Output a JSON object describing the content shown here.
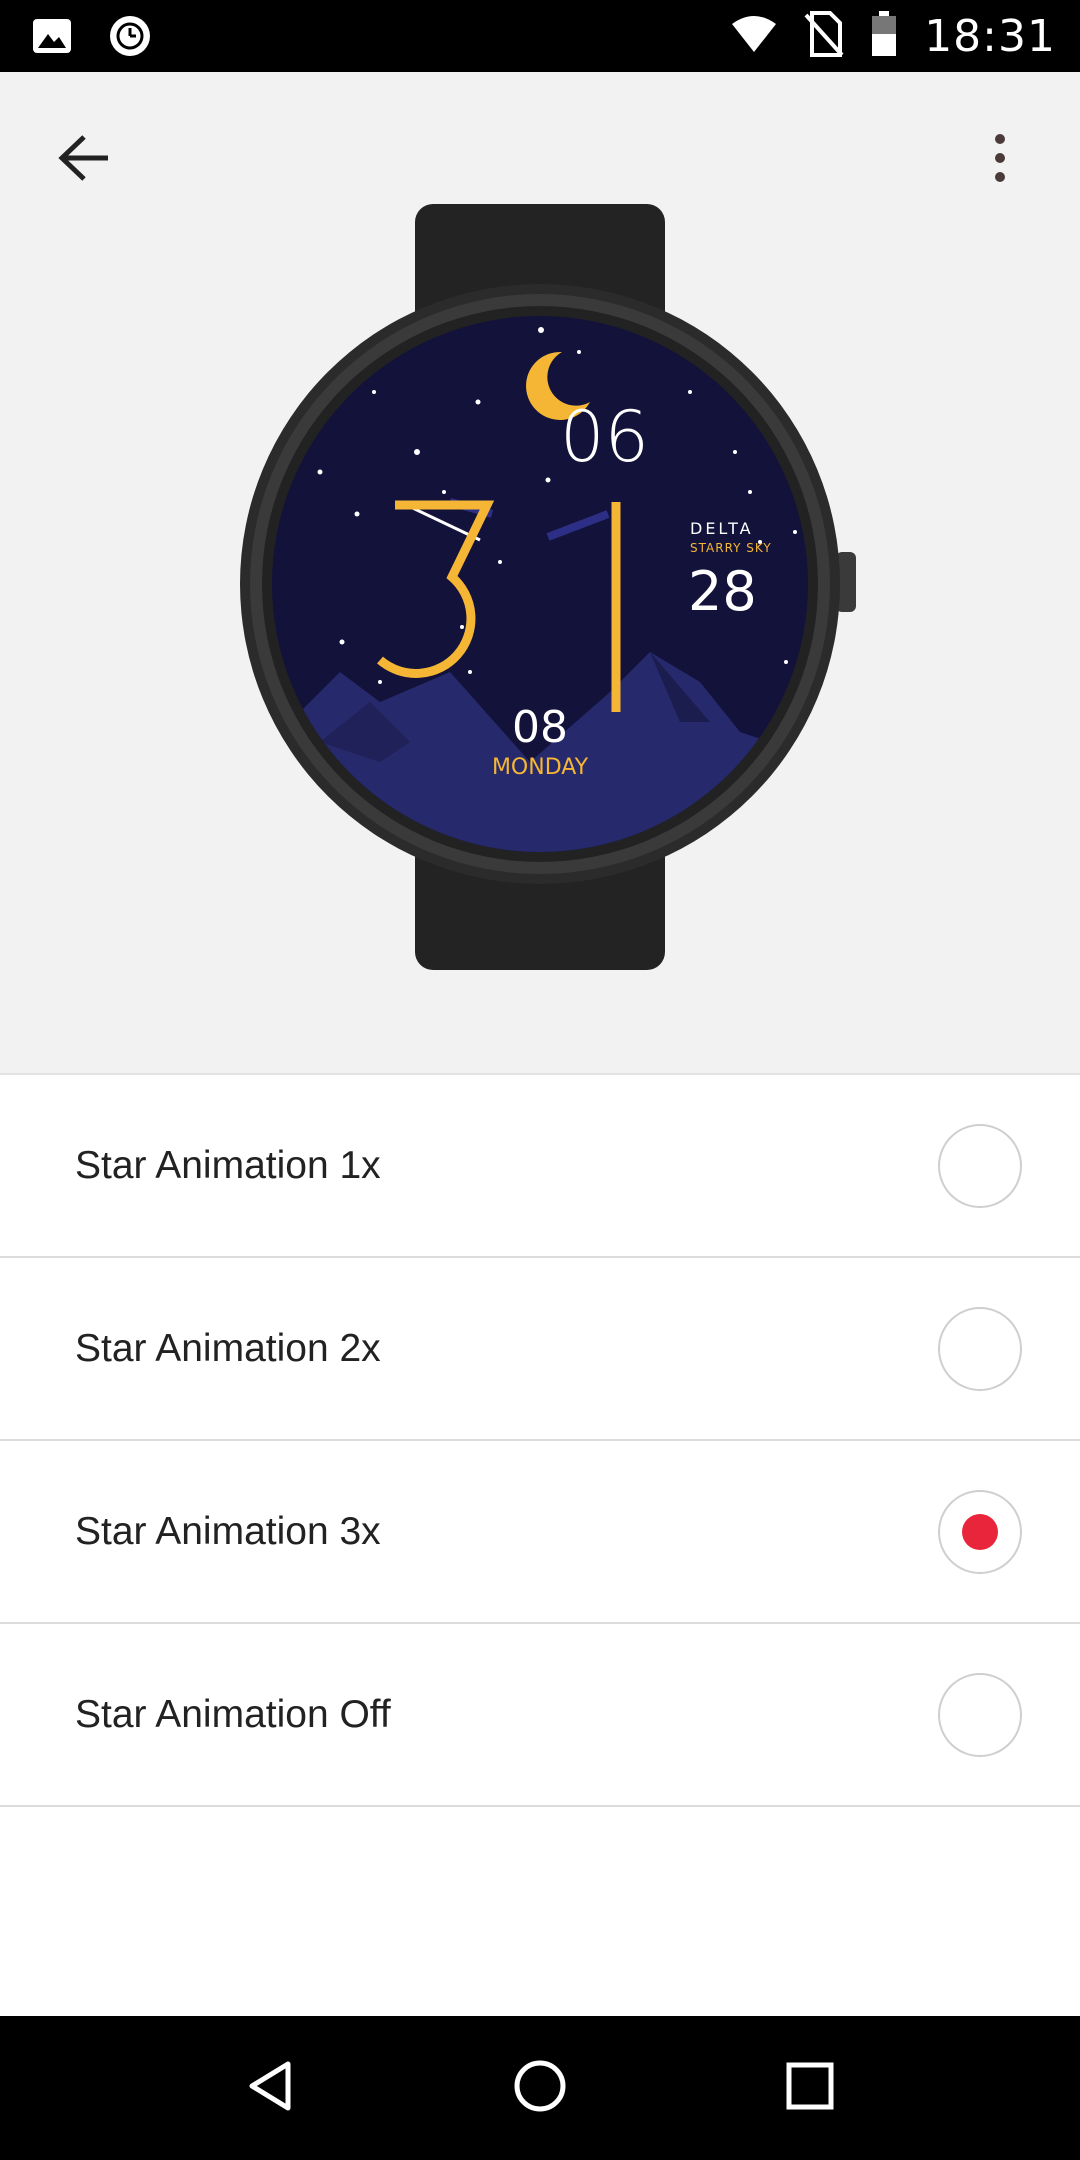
{
  "status_bar": {
    "time": "18:31",
    "left_icons": [
      "image-icon",
      "clock-badge-icon"
    ],
    "right_icons": [
      "wifi-icon",
      "no-sim-icon",
      "battery-icon"
    ]
  },
  "header": {
    "back_icon": "arrow-left-icon",
    "more_icon": "more-vertical-icon"
  },
  "watch_face": {
    "hour": "3",
    "minute": "1",
    "top_number": "06",
    "brand": "DELTA",
    "subtitle": "STARRY SKY",
    "side_number": "28",
    "day_number": "08",
    "weekday": "MONDAY",
    "colors": {
      "sky": "#13123a",
      "accent": "#f5b635",
      "mountain": "#26296b"
    }
  },
  "options": [
    {
      "label": "Star Animation 1x",
      "selected": false
    },
    {
      "label": "Star Animation 2x",
      "selected": false
    },
    {
      "label": "Star Animation 3x",
      "selected": true
    },
    {
      "label": "Star Animation Off",
      "selected": false
    }
  ],
  "nav_bar": {
    "icons": [
      "back-triangle-icon",
      "home-circle-icon",
      "recents-square-icon"
    ]
  },
  "colors": {
    "radio_selected": "#e8253a",
    "status_bar": "#000000",
    "preview_bg": "#f2f2f2"
  }
}
